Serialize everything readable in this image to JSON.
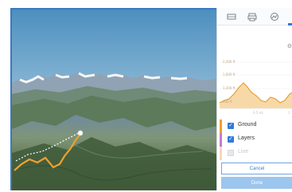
{
  "panel": {
    "toolbar": [
      {
        "icon": "layers-icon"
      },
      {
        "icon": "print-icon"
      },
      {
        "icon": "elevation-icon"
      }
    ],
    "profile": {
      "y_ticks": [
        "2,000 ft",
        "1,600 ft",
        "1,200 ft",
        "800 ft"
      ],
      "x_ticks": [
        "0.5 mi",
        "1"
      ],
      "fill_color": "#f7d9a8",
      "line_color": "#e89a2c"
    },
    "layers": [
      {
        "label": "Ground",
        "checked": true,
        "color": "#f0a030"
      },
      {
        "label": "Layers",
        "checked": true,
        "color": "#c57ad0"
      },
      {
        "label": "Line",
        "checked": false,
        "color": "#f2d9b8"
      }
    ],
    "cancel_label": "Cancel",
    "done_label": "Done"
  },
  "scene": {
    "route_color": "#f0a030",
    "accent": "#2f7bd6"
  }
}
